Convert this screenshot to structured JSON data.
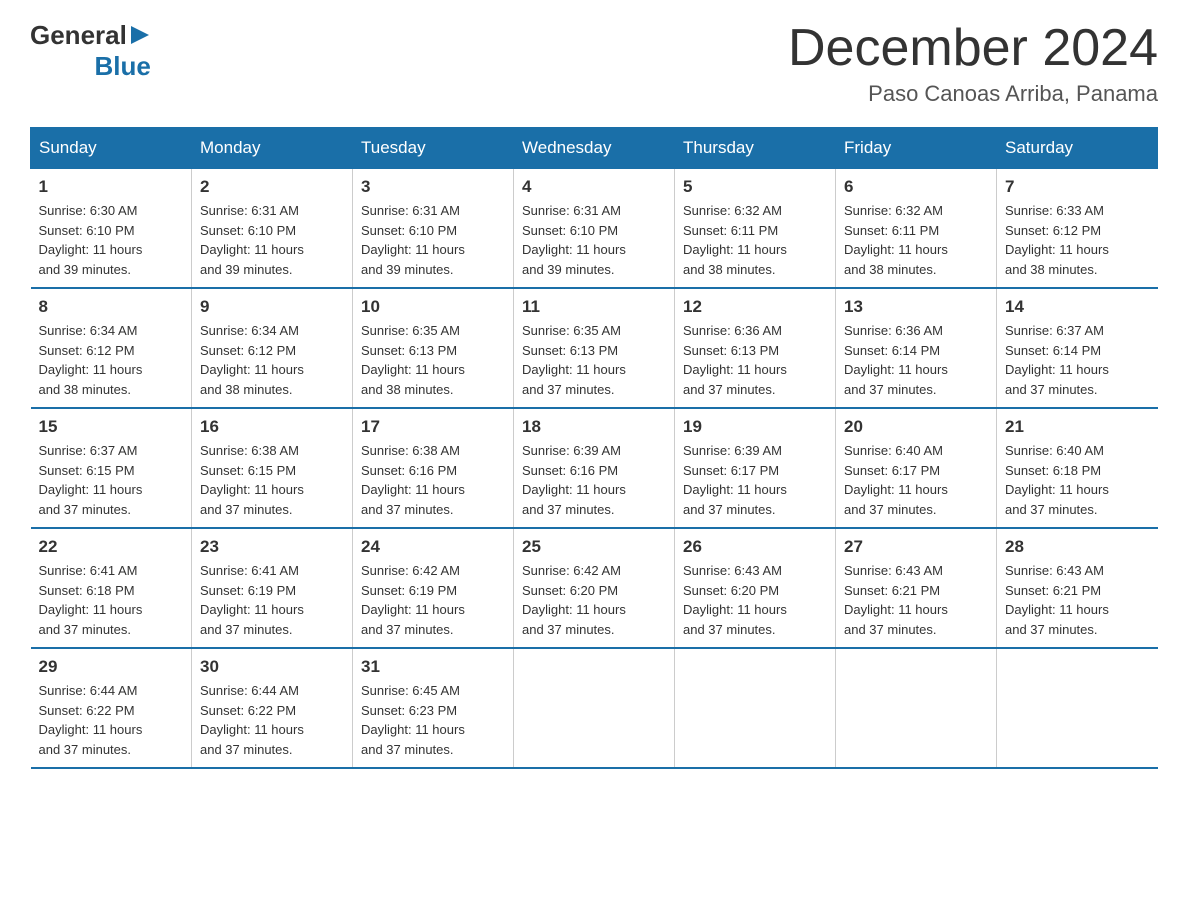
{
  "logo": {
    "general": "General",
    "arrow": "▶",
    "blue": "Blue"
  },
  "title": "December 2024",
  "location": "Paso Canoas Arriba, Panama",
  "days_header": [
    "Sunday",
    "Monday",
    "Tuesday",
    "Wednesday",
    "Thursday",
    "Friday",
    "Saturday"
  ],
  "weeks": [
    [
      {
        "day": "1",
        "sunrise": "6:30 AM",
        "sunset": "6:10 PM",
        "daylight": "11 hours and 39 minutes."
      },
      {
        "day": "2",
        "sunrise": "6:31 AM",
        "sunset": "6:10 PM",
        "daylight": "11 hours and 39 minutes."
      },
      {
        "day": "3",
        "sunrise": "6:31 AM",
        "sunset": "6:10 PM",
        "daylight": "11 hours and 39 minutes."
      },
      {
        "day": "4",
        "sunrise": "6:31 AM",
        "sunset": "6:10 PM",
        "daylight": "11 hours and 39 minutes."
      },
      {
        "day": "5",
        "sunrise": "6:32 AM",
        "sunset": "6:11 PM",
        "daylight": "11 hours and 38 minutes."
      },
      {
        "day": "6",
        "sunrise": "6:32 AM",
        "sunset": "6:11 PM",
        "daylight": "11 hours and 38 minutes."
      },
      {
        "day": "7",
        "sunrise": "6:33 AM",
        "sunset": "6:12 PM",
        "daylight": "11 hours and 38 minutes."
      }
    ],
    [
      {
        "day": "8",
        "sunrise": "6:34 AM",
        "sunset": "6:12 PM",
        "daylight": "11 hours and 38 minutes."
      },
      {
        "day": "9",
        "sunrise": "6:34 AM",
        "sunset": "6:12 PM",
        "daylight": "11 hours and 38 minutes."
      },
      {
        "day": "10",
        "sunrise": "6:35 AM",
        "sunset": "6:13 PM",
        "daylight": "11 hours and 38 minutes."
      },
      {
        "day": "11",
        "sunrise": "6:35 AM",
        "sunset": "6:13 PM",
        "daylight": "11 hours and 37 minutes."
      },
      {
        "day": "12",
        "sunrise": "6:36 AM",
        "sunset": "6:13 PM",
        "daylight": "11 hours and 37 minutes."
      },
      {
        "day": "13",
        "sunrise": "6:36 AM",
        "sunset": "6:14 PM",
        "daylight": "11 hours and 37 minutes."
      },
      {
        "day": "14",
        "sunrise": "6:37 AM",
        "sunset": "6:14 PM",
        "daylight": "11 hours and 37 minutes."
      }
    ],
    [
      {
        "day": "15",
        "sunrise": "6:37 AM",
        "sunset": "6:15 PM",
        "daylight": "11 hours and 37 minutes."
      },
      {
        "day": "16",
        "sunrise": "6:38 AM",
        "sunset": "6:15 PM",
        "daylight": "11 hours and 37 minutes."
      },
      {
        "day": "17",
        "sunrise": "6:38 AM",
        "sunset": "6:16 PM",
        "daylight": "11 hours and 37 minutes."
      },
      {
        "day": "18",
        "sunrise": "6:39 AM",
        "sunset": "6:16 PM",
        "daylight": "11 hours and 37 minutes."
      },
      {
        "day": "19",
        "sunrise": "6:39 AM",
        "sunset": "6:17 PM",
        "daylight": "11 hours and 37 minutes."
      },
      {
        "day": "20",
        "sunrise": "6:40 AM",
        "sunset": "6:17 PM",
        "daylight": "11 hours and 37 minutes."
      },
      {
        "day": "21",
        "sunrise": "6:40 AM",
        "sunset": "6:18 PM",
        "daylight": "11 hours and 37 minutes."
      }
    ],
    [
      {
        "day": "22",
        "sunrise": "6:41 AM",
        "sunset": "6:18 PM",
        "daylight": "11 hours and 37 minutes."
      },
      {
        "day": "23",
        "sunrise": "6:41 AM",
        "sunset": "6:19 PM",
        "daylight": "11 hours and 37 minutes."
      },
      {
        "day": "24",
        "sunrise": "6:42 AM",
        "sunset": "6:19 PM",
        "daylight": "11 hours and 37 minutes."
      },
      {
        "day": "25",
        "sunrise": "6:42 AM",
        "sunset": "6:20 PM",
        "daylight": "11 hours and 37 minutes."
      },
      {
        "day": "26",
        "sunrise": "6:43 AM",
        "sunset": "6:20 PM",
        "daylight": "11 hours and 37 minutes."
      },
      {
        "day": "27",
        "sunrise": "6:43 AM",
        "sunset": "6:21 PM",
        "daylight": "11 hours and 37 minutes."
      },
      {
        "day": "28",
        "sunrise": "6:43 AM",
        "sunset": "6:21 PM",
        "daylight": "11 hours and 37 minutes."
      }
    ],
    [
      {
        "day": "29",
        "sunrise": "6:44 AM",
        "sunset": "6:22 PM",
        "daylight": "11 hours and 37 minutes."
      },
      {
        "day": "30",
        "sunrise": "6:44 AM",
        "sunset": "6:22 PM",
        "daylight": "11 hours and 37 minutes."
      },
      {
        "day": "31",
        "sunrise": "6:45 AM",
        "sunset": "6:23 PM",
        "daylight": "11 hours and 37 minutes."
      },
      null,
      null,
      null,
      null
    ]
  ],
  "colors": {
    "header_bg": "#1a6fa8",
    "header_text": "#ffffff",
    "border": "#1a6fa8",
    "text": "#333333"
  },
  "labels": {
    "sunrise": "Sunrise:",
    "sunset": "Sunset:",
    "daylight": "Daylight:"
  }
}
